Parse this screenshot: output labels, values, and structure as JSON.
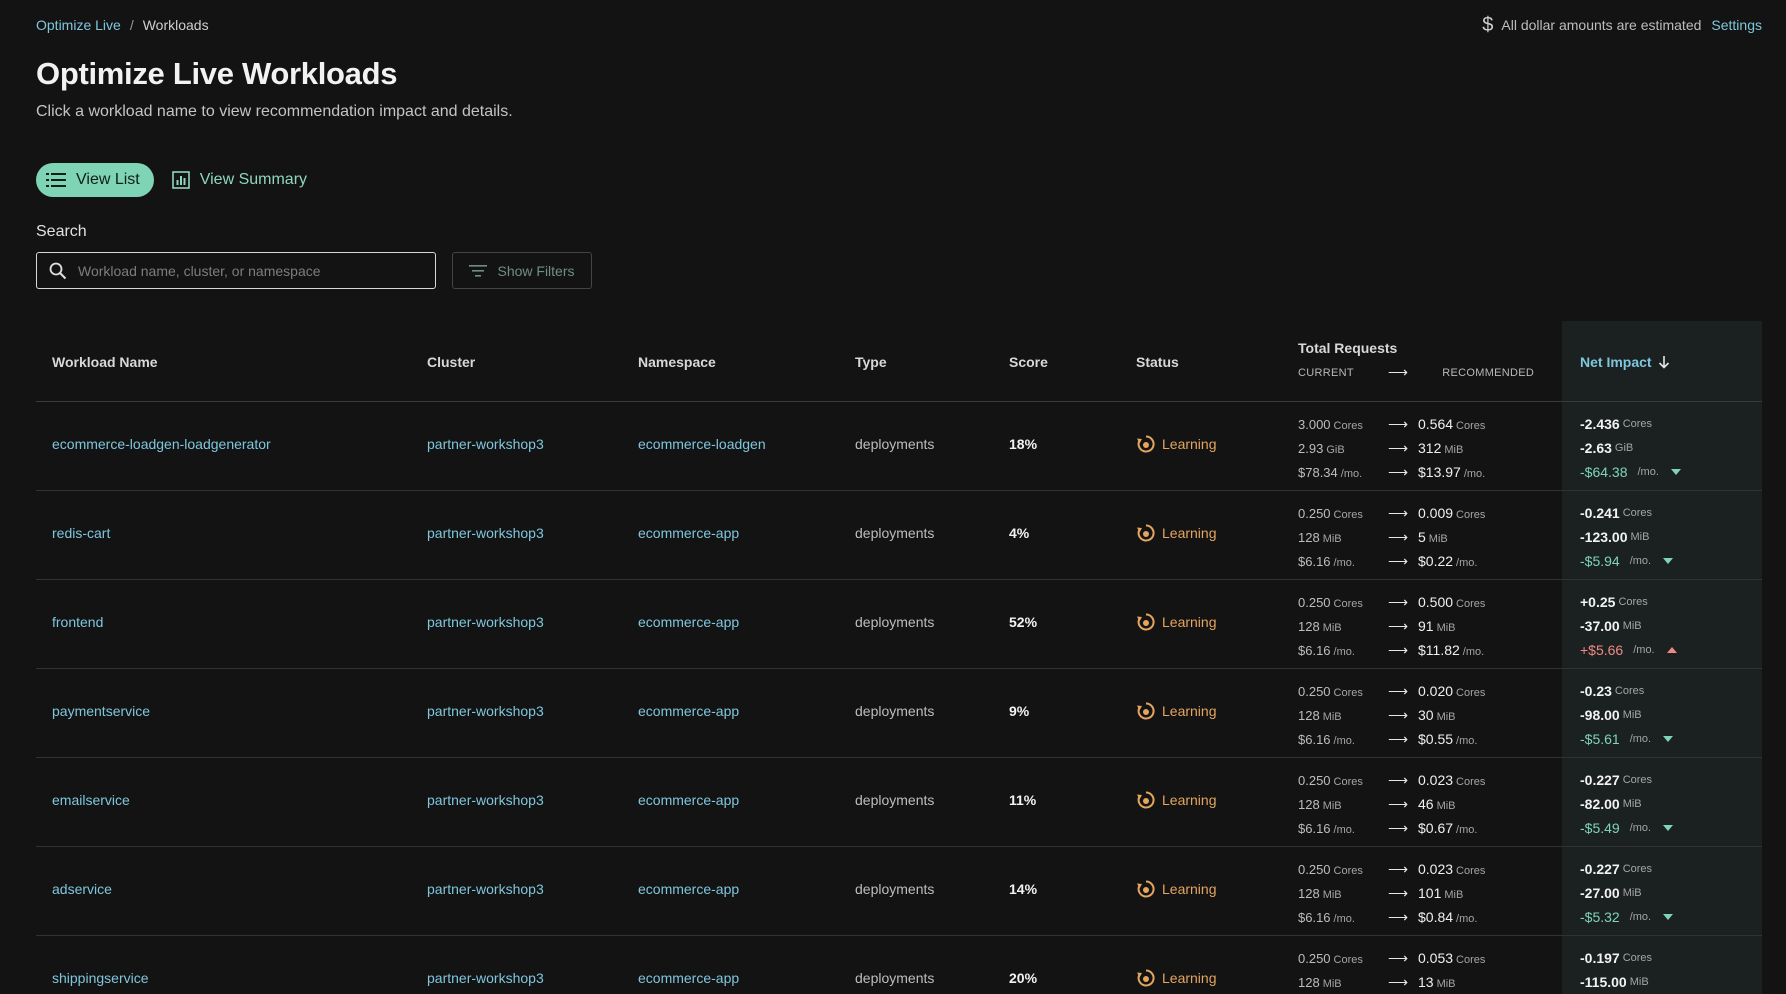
{
  "breadcrumb": {
    "root": "Optimize Live",
    "separator": "/",
    "current": "Workloads"
  },
  "notice": {
    "text": "All dollar amounts are estimated",
    "settings": "Settings"
  },
  "page": {
    "title": "Optimize Live Workloads",
    "subtitle": "Click a workload name to view recommendation impact and details."
  },
  "view_tabs": {
    "list": "View List",
    "summary": "View Summary"
  },
  "search": {
    "label": "Search",
    "placeholder": "Workload name, cluster, or namespace",
    "filters": "Show Filters"
  },
  "columns": {
    "name": "Workload Name",
    "cluster": "Cluster",
    "namespace": "Namespace",
    "type": "Type",
    "score": "Score",
    "status": "Status",
    "total_requests": "Total Requests",
    "current": "CURRENT",
    "recommended": "RECOMMENDED",
    "net_impact": "Net Impact"
  },
  "units": {
    "cores": "Cores",
    "per_month": "/mo.",
    "arrow": "⟶"
  },
  "rows": [
    {
      "name": "ecommerce-loadgen-loadgenerator",
      "cluster": "partner-workshop3",
      "namespace": "ecommerce-loadgen",
      "type": "deployments",
      "score": "18%",
      "status": "Learning",
      "cur_cpu": "3.000",
      "rec_cpu": "0.564",
      "cur_mem": "2.93",
      "cur_mem_unit": "GiB",
      "rec_mem": "312",
      "rec_mem_unit": "MiB",
      "cur_cost": "$78.34",
      "rec_cost": "$13.97",
      "net_cpu": "-2.436",
      "net_mem": "-2.63",
      "net_mem_unit": "GiB",
      "net_cost": "-$64.38",
      "direction": "down"
    },
    {
      "name": "redis-cart",
      "cluster": "partner-workshop3",
      "namespace": "ecommerce-app",
      "type": "deployments",
      "score": "4%",
      "status": "Learning",
      "cur_cpu": "0.250",
      "rec_cpu": "0.009",
      "cur_mem": "128",
      "cur_mem_unit": "MiB",
      "rec_mem": "5",
      "rec_mem_unit": "MiB",
      "cur_cost": "$6.16",
      "rec_cost": "$0.22",
      "net_cpu": "-0.241",
      "net_mem": "-123.00",
      "net_mem_unit": "MiB",
      "net_cost": "-$5.94",
      "direction": "down"
    },
    {
      "name": "frontend",
      "cluster": "partner-workshop3",
      "namespace": "ecommerce-app",
      "type": "deployments",
      "score": "52%",
      "status": "Learning",
      "cur_cpu": "0.250",
      "rec_cpu": "0.500",
      "cur_mem": "128",
      "cur_mem_unit": "MiB",
      "rec_mem": "91",
      "rec_mem_unit": "MiB",
      "cur_cost": "$6.16",
      "rec_cost": "$11.82",
      "net_cpu": "+0.25",
      "net_mem": "-37.00",
      "net_mem_unit": "MiB",
      "net_cost": "+$5.66",
      "direction": "up"
    },
    {
      "name": "paymentservice",
      "cluster": "partner-workshop3",
      "namespace": "ecommerce-app",
      "type": "deployments",
      "score": "9%",
      "status": "Learning",
      "cur_cpu": "0.250",
      "rec_cpu": "0.020",
      "cur_mem": "128",
      "cur_mem_unit": "MiB",
      "rec_mem": "30",
      "rec_mem_unit": "MiB",
      "cur_cost": "$6.16",
      "rec_cost": "$0.55",
      "net_cpu": "-0.23",
      "net_mem": "-98.00",
      "net_mem_unit": "MiB",
      "net_cost": "-$5.61",
      "direction": "down"
    },
    {
      "name": "emailservice",
      "cluster": "partner-workshop3",
      "namespace": "ecommerce-app",
      "type": "deployments",
      "score": "11%",
      "status": "Learning",
      "cur_cpu": "0.250",
      "rec_cpu": "0.023",
      "cur_mem": "128",
      "cur_mem_unit": "MiB",
      "rec_mem": "46",
      "rec_mem_unit": "MiB",
      "cur_cost": "$6.16",
      "rec_cost": "$0.67",
      "net_cpu": "-0.227",
      "net_mem": "-82.00",
      "net_mem_unit": "MiB",
      "net_cost": "-$5.49",
      "direction": "down"
    },
    {
      "name": "adservice",
      "cluster": "partner-workshop3",
      "namespace": "ecommerce-app",
      "type": "deployments",
      "score": "14%",
      "status": "Learning",
      "cur_cpu": "0.250",
      "rec_cpu": "0.023",
      "cur_mem": "128",
      "cur_mem_unit": "MiB",
      "rec_mem": "101",
      "rec_mem_unit": "MiB",
      "cur_cost": "$6.16",
      "rec_cost": "$0.84",
      "net_cpu": "-0.227",
      "net_mem": "-27.00",
      "net_mem_unit": "MiB",
      "net_cost": "-$5.32",
      "direction": "down"
    },
    {
      "name": "shippingservice",
      "cluster": "partner-workshop3",
      "namespace": "ecommerce-app",
      "type": "deployments",
      "score": "20%",
      "status": "Learning",
      "cur_cpu": "0.250",
      "rec_cpu": "0.053",
      "cur_mem": "128",
      "cur_mem_unit": "MiB",
      "rec_mem": "13",
      "rec_mem_unit": "MiB",
      "cur_cost": null,
      "rec_cost": null,
      "net_cpu": "-0.197",
      "net_mem": "-115.00",
      "net_mem_unit": "MiB",
      "net_cost": null,
      "direction": null
    }
  ],
  "colors": {
    "accent": "#7fd4b6",
    "link": "#7fc6dd",
    "warning": "#e3a55f",
    "negative": "#f08a86",
    "background": "#131313"
  },
  "icons": {
    "dollar": "dollar-icon",
    "list": "list-icon",
    "summary": "chart-icon",
    "search": "search-icon",
    "filter": "filter-icon",
    "sort": "arrow-down-icon",
    "status": "learning-icon"
  }
}
